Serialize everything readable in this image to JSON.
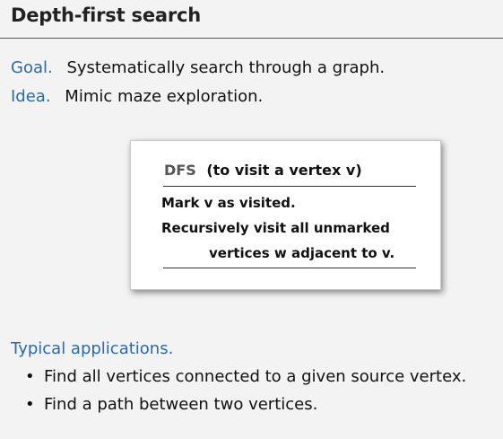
{
  "slide": {
    "title": "Depth-first search",
    "goal": {
      "label": "Goal.",
      "text": "Systematically search through a graph."
    },
    "idea": {
      "label": "Idea.",
      "text": "Mimic maze exploration."
    },
    "algorithm": {
      "name": "DFS",
      "subtitle": "(to visit a vertex v)",
      "steps": [
        "Mark v as visited.",
        "Recursively visit all unmarked",
        "vertices w adjacent to v."
      ]
    },
    "applications": {
      "heading": "Typical applications.",
      "bullet": "•",
      "items": [
        "Find all vertices connected to a given source vertex.",
        "Find a path between two vertices."
      ]
    }
  },
  "colors": {
    "background": "#f3f3f3",
    "keyword_blue": "#2b6aa7",
    "box_background": "#ffffff",
    "text": "#111111"
  }
}
